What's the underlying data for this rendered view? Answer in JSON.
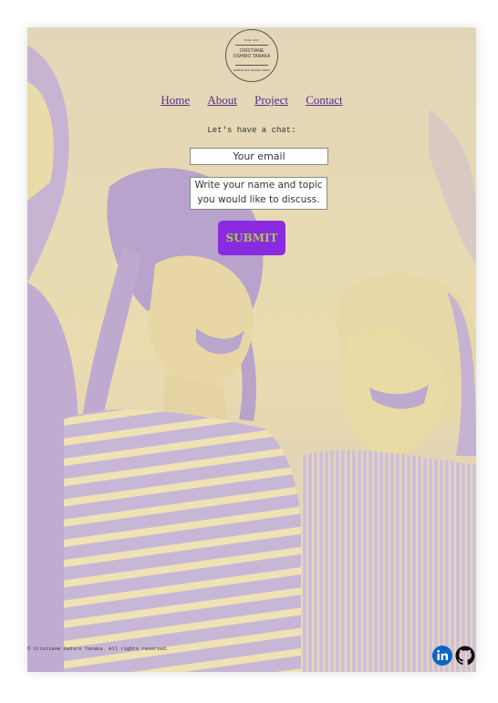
{
  "logo": {
    "top_text": "ONE DAY",
    "name_line1": "CRISTIANE",
    "name_line2": "OSHIRO TANAKA",
    "bottom_text": "WEBSITES DEVELOPER"
  },
  "nav": {
    "items": [
      {
        "label": "Home"
      },
      {
        "label": "About"
      },
      {
        "label": "Project"
      },
      {
        "label": "Contact"
      }
    ]
  },
  "contact_form": {
    "heading": "Let's have a chat:",
    "email_placeholder": "Your email",
    "message_placeholder": "Write your name and topic you would like to discuss.",
    "submit_label": "SUBMIT"
  },
  "footer": {
    "copyright": "© Cristiane Oshiro Tanaka. All rights reserved.",
    "social_icons": [
      "linkedin-icon",
      "github-icon"
    ]
  },
  "colors": {
    "background_tint_light": "#ecdeb0",
    "background_tint_dark": "#b7a6cf",
    "submit_bg": "#8a2be2",
    "submit_text": "#a9c947",
    "link": "#5a2d8c",
    "linkedin_blue": "#0a66c2"
  }
}
